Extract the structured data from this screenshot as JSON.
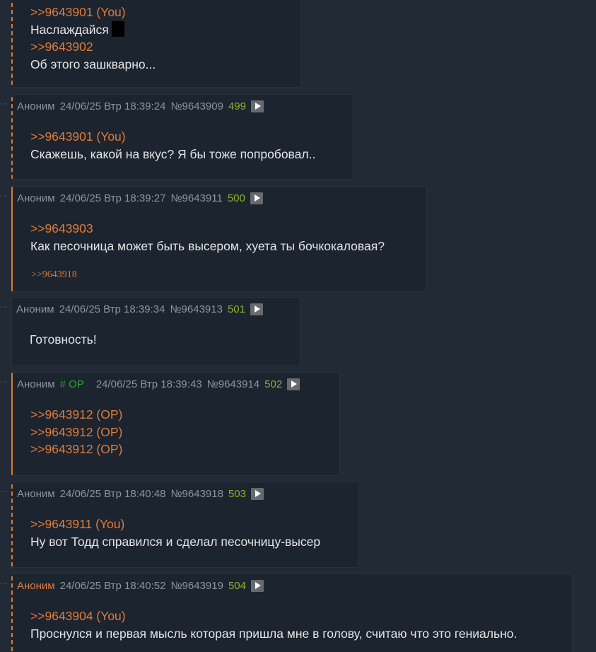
{
  "posts": [
    {
      "lines": [
        {
          "text": ">>9643901 (You)",
          "type": "ref"
        },
        {
          "text": "Наслаждайся",
          "type": "text"
        },
        {
          "text": ">>9643902",
          "type": "ref"
        },
        {
          "text": "Об этого зашкварно...",
          "type": "text"
        }
      ]
    },
    {
      "author": "Аноним",
      "date": "24/06/25 Втр 18:39:24",
      "num": "№9643909",
      "count": "499",
      "lines": [
        {
          "text": ">>9643901 (You)",
          "type": "ref"
        },
        {
          "text": "Скажешь, какой на вкус? Я бы тоже попробовал..",
          "type": "text"
        }
      ]
    },
    {
      "author": "Аноним",
      "date": "24/06/25 Втр 18:39:27",
      "num": "№9643911",
      "count": "500",
      "lines": [
        {
          "text": ">>9643903",
          "type": "ref"
        },
        {
          "text": "Как песочница может быть высером, хуета ты бочкокаловая?",
          "type": "text"
        }
      ],
      "replies": ">>9643918"
    },
    {
      "author": "Аноним",
      "date": "24/06/25 Втр 18:39:34",
      "num": "№9643913",
      "count": "501",
      "lines": [
        {
          "text": "Готовность!",
          "type": "text"
        }
      ]
    },
    {
      "author": "Аноним",
      "trip": "# OP",
      "date": "24/06/25 Втр 18:39:43",
      "num": "№9643914",
      "count": "502",
      "lines": [
        {
          "text": ">>9643912 (OP)",
          "type": "ref"
        },
        {
          "text": ">>9643912 (OP)",
          "type": "ref"
        },
        {
          "text": ">>9643912 (OP)",
          "type": "ref"
        }
      ]
    },
    {
      "author": "Аноним",
      "date": "24/06/25 Втр 18:40:48",
      "num": "№9643918",
      "count": "503",
      "lines": [
        {
          "text": ">>9643911 (You)",
          "type": "ref"
        },
        {
          "text": "Ну вот Тодд справился и сделал песочницу-высер",
          "type": "text"
        }
      ]
    },
    {
      "author": "Аноним",
      "date": "24/06/25 Втр 18:40:52",
      "num": "№9643919",
      "count": "504",
      "lines": [
        {
          "text": ">>9643904 (You)",
          "type": "ref"
        },
        {
          "text": "Проснулся и первая мысль которая пришла мне в голову, считаю что это гениально.",
          "type": "text"
        }
      ]
    }
  ],
  "colors": {
    "background": "#212a35",
    "post_background": "#1c2430",
    "reference": "#e07b3a",
    "post_count": "#8fb02a",
    "op_trip": "#2fa52f"
  }
}
